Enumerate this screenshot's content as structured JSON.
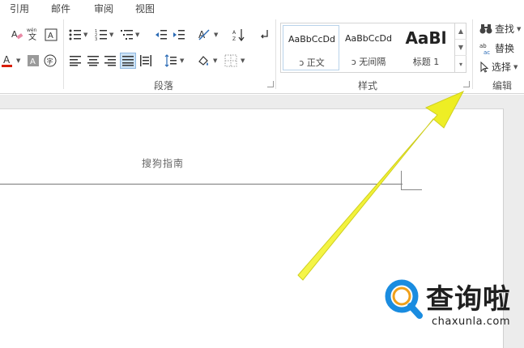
{
  "tabs": [
    "引用",
    "邮件",
    "审阅",
    "视图"
  ],
  "groups": {
    "paragraph": "段落",
    "styles": "样式",
    "editing": "编辑"
  },
  "styles_gallery": [
    {
      "sample": "AaBbCcDd",
      "name": "正文"
    },
    {
      "sample": "AaBbCcDd",
      "name": "无间隔"
    },
    {
      "sample": "AaBl",
      "name": "标题 1"
    }
  ],
  "editing": {
    "find": "查找",
    "replace": "替换",
    "select": "选择"
  },
  "document": {
    "header_text": "搜狗指南"
  },
  "watermark": {
    "cn": "查询啦",
    "en": "chaxunla.com"
  },
  "colors": {
    "arrow": "#f2f232",
    "watermark_blue": "#1a8ce0",
    "font_color_red": "#d81e06"
  }
}
